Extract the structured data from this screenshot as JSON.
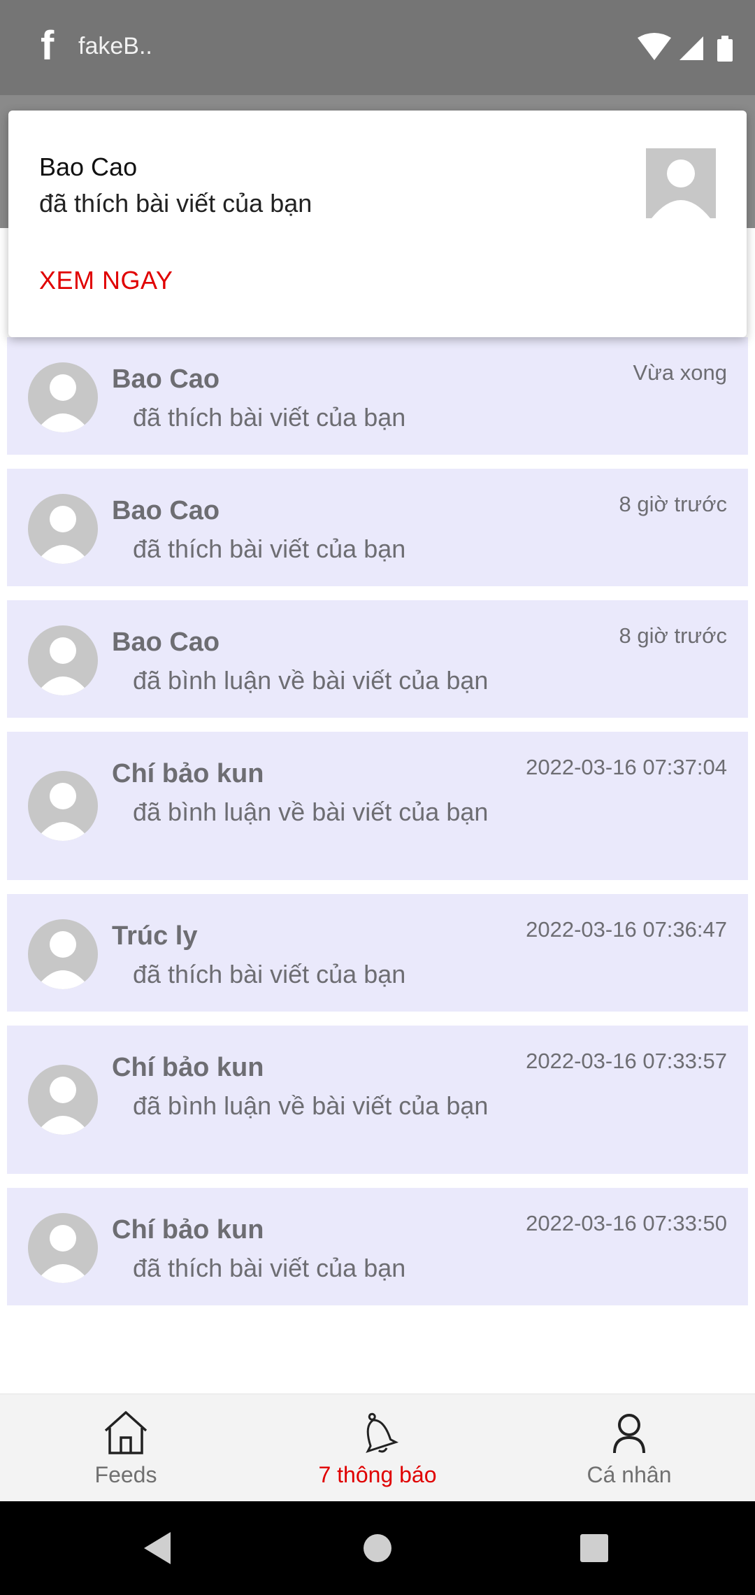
{
  "status_bar": {
    "app_name": "fakeB..",
    "icons": [
      "facebook-icon",
      "wifi-icon",
      "signal-icon",
      "battery-icon"
    ]
  },
  "heads_up": {
    "title": "Bao Cao",
    "text": "đã thích bài viết của bạn",
    "action": "XEM NGAY"
  },
  "notifications": [
    {
      "name": "Bao Cao",
      "message": "đã thích bài viết của bạn",
      "time": "Vừa xong"
    },
    {
      "name": "Bao Cao",
      "message": "đã thích bài viết của bạn",
      "time": "8 giờ trước"
    },
    {
      "name": "Bao Cao",
      "message": "đã bình luận về bài viết của bạn",
      "time": "8 giờ trước"
    },
    {
      "name": "Chí bảo kun",
      "message": "đã bình luận về bài viết của bạn",
      "time": "2022-03-16 07:37:04"
    },
    {
      "name": "Trúc ly",
      "message": "đã thích bài viết của bạn",
      "time": "2022-03-16 07:36:47"
    },
    {
      "name": "Chí bảo kun",
      "message": "đã bình luận về bài viết của bạn",
      "time": "2022-03-16 07:33:57"
    },
    {
      "name": "Chí bảo kun",
      "message": "đã thích bài viết của bạn",
      "time": "2022-03-16 07:33:50"
    }
  ],
  "tabs": [
    {
      "label": "Feeds",
      "icon": "home-icon",
      "active": false
    },
    {
      "label": "7 thông báo",
      "icon": "bell-icon",
      "active": true
    },
    {
      "label": "Cá nhân",
      "icon": "person-icon",
      "active": false
    }
  ],
  "colors": {
    "accent": "#e00000",
    "item_background": "#eae9fb",
    "text_muted": "#6d6d72"
  }
}
